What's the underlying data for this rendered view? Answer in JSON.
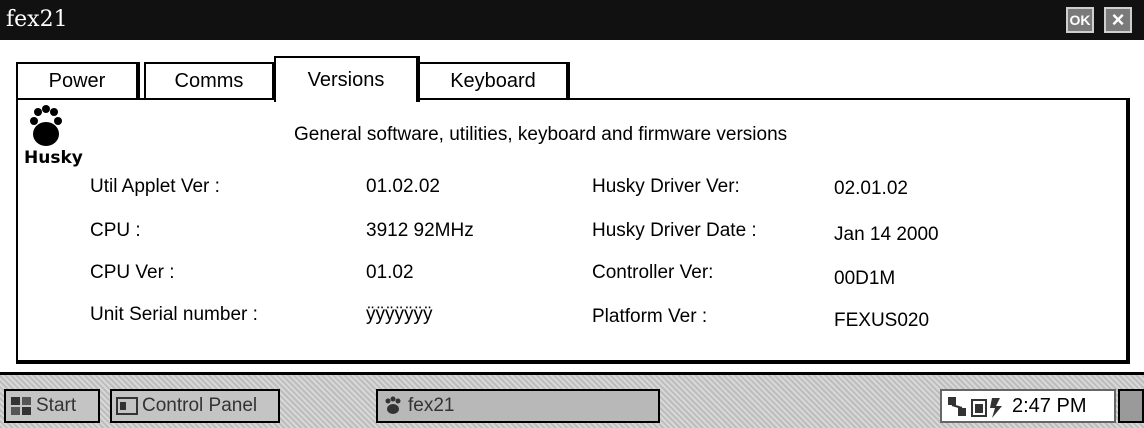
{
  "window": {
    "title": "fex21",
    "ok_label": "OK",
    "close_label": "×"
  },
  "tabs": [
    {
      "label": "Power",
      "active": false
    },
    {
      "label": "Comms",
      "active": false
    },
    {
      "label": "Versions",
      "active": true
    },
    {
      "label": "Keyboard",
      "active": false
    }
  ],
  "panel": {
    "logo_text": "Husky",
    "heading": "General software, utilities, keyboard and firmware versions",
    "left_rows": [
      {
        "label": "Util Applet Ver :",
        "value": "01.02.02"
      },
      {
        "label": "CPU :",
        "value": "3912 92MHz"
      },
      {
        "label": "CPU Ver :",
        "value": "01.02"
      },
      {
        "label": "Unit Serial number :",
        "value": "ÿÿÿÿÿÿÿ"
      }
    ],
    "right_rows": [
      {
        "label": "Husky Driver Ver:",
        "value": "02.01.02"
      },
      {
        "label": "Husky Driver Date :",
        "value": "Jan 14 2000"
      },
      {
        "label": "Controller Ver:",
        "value": "00D1M"
      },
      {
        "label": "Platform Ver :",
        "value": "FEXUS020"
      }
    ]
  },
  "taskbar": {
    "start_label": "Start",
    "control_panel_label": "Control Panel",
    "task_label": "fex21",
    "clock": "2:47 PM"
  },
  "colors": {
    "titlebar": "#111111",
    "panel_bg": "#ffffff",
    "window_bg": "#d4d0c8"
  }
}
